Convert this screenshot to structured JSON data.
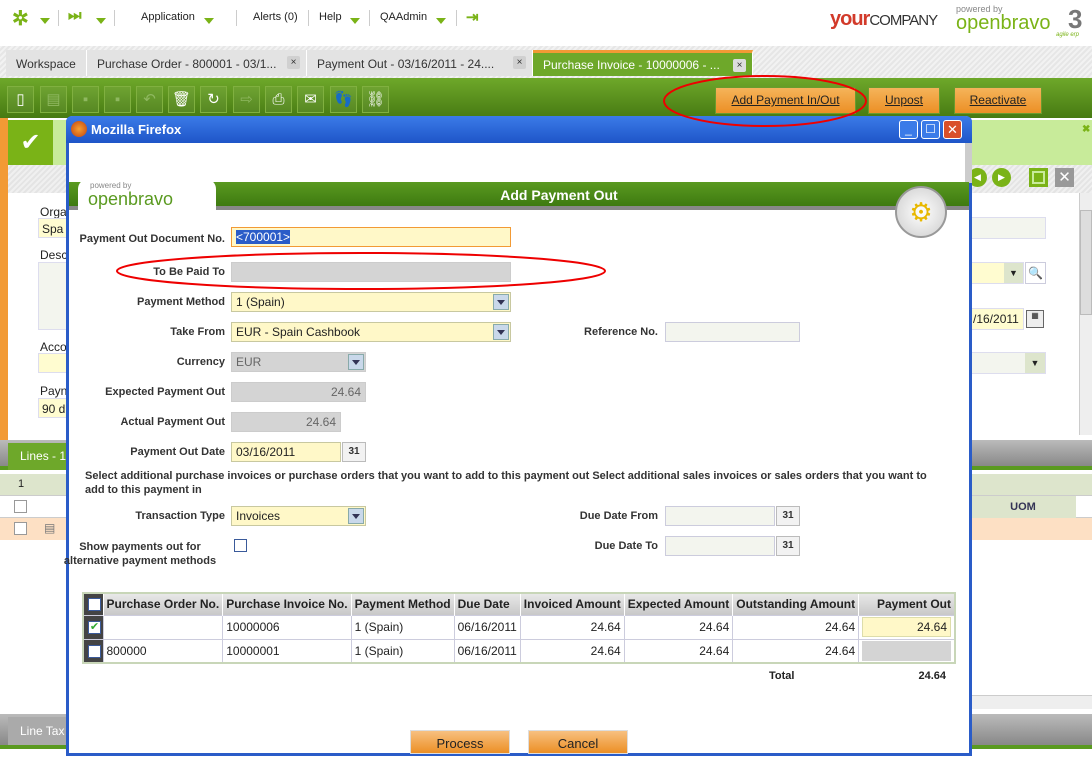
{
  "nav": {
    "application": "Application",
    "alerts": "Alerts (0)",
    "help": "Help",
    "user": "QAAdmin"
  },
  "brand": {
    "company_your": "your",
    "company_rest": "COMPANY",
    "powered_by": "powered by",
    "openbravo": "openbravo",
    "version": "3",
    "tagline": "agile erp"
  },
  "tabs": [
    {
      "label": "Workspace"
    },
    {
      "label": "Purchase Order - 800001 - 03/1..."
    },
    {
      "label": "Payment Out - 03/16/2011 - 24...."
    },
    {
      "label": "Purchase Invoice - 10000006 - ..."
    }
  ],
  "toolbar": {
    "add_payment": "Add Payment In/Out",
    "unpost": "Unpost",
    "reactivate": "Reactivate"
  },
  "background": {
    "lines_tab": "Lines - 1",
    "line_tax_tab": "Line Tax",
    "grid_count": "1",
    "uom_header": "UOM",
    "date_partial": "/16/2011",
    "org_label": "Orga",
    "org_value": "Spa",
    "desc_label": "Desc",
    "acct_label": "Acco",
    "pay_label": "Payn",
    "pay_value": "90 d"
  },
  "dialog": {
    "window_title": "Mozilla Firefox",
    "title": "Add Payment Out",
    "fields": {
      "doc_no_label": "Payment Out Document No.",
      "doc_no_value": "<700001>",
      "paid_to_label": "To Be Paid To",
      "paid_to_value": "",
      "method_label": "Payment Method",
      "method_value": "1 (Spain)",
      "take_from_label": "Take From",
      "take_from_value": "EUR - Spain Cashbook",
      "reference_label": "Reference No.",
      "reference_value": "",
      "currency_label": "Currency",
      "currency_value": "EUR",
      "expected_label": "Expected Payment Out",
      "expected_value": "24.64",
      "actual_label": "Actual Payment Out",
      "actual_value": "24.64",
      "date_label": "Payment Out Date",
      "date_value": "03/16/2011",
      "instructions": "Select additional purchase invoices or purchase orders that you want to add to this payment out Select additional sales invoices or sales orders that you want to add to this payment in",
      "trx_type_label": "Transaction Type",
      "trx_type_value": "Invoices",
      "due_from_label": "Due Date From",
      "due_to_label": "Due Date To",
      "show_alt_label": "Show payments out for alternative payment methods"
    },
    "table": {
      "headers": [
        "Purchase Order No.",
        "Purchase Invoice No.",
        "Payment Method",
        "Due Date",
        "Invoiced Amount",
        "Expected Amount",
        "Outstanding Amount",
        "Payment Out"
      ],
      "rows": [
        {
          "checked": true,
          "po": "",
          "pi": "10000006",
          "method": "1 (Spain)",
          "due": "06/16/2011",
          "invoiced": "24.64",
          "expected": "24.64",
          "outstanding": "24.64",
          "payment": "24.64"
        },
        {
          "checked": false,
          "po": "800000",
          "pi": "10000001",
          "method": "1 (Spain)",
          "due": "06/16/2011",
          "invoiced": "24.64",
          "expected": "24.64",
          "outstanding": "24.64",
          "payment": ""
        }
      ],
      "total_label": "Total",
      "total_value": "24.64"
    },
    "process": "Process",
    "cancel": "Cancel"
  },
  "calendar_glyph": "31"
}
